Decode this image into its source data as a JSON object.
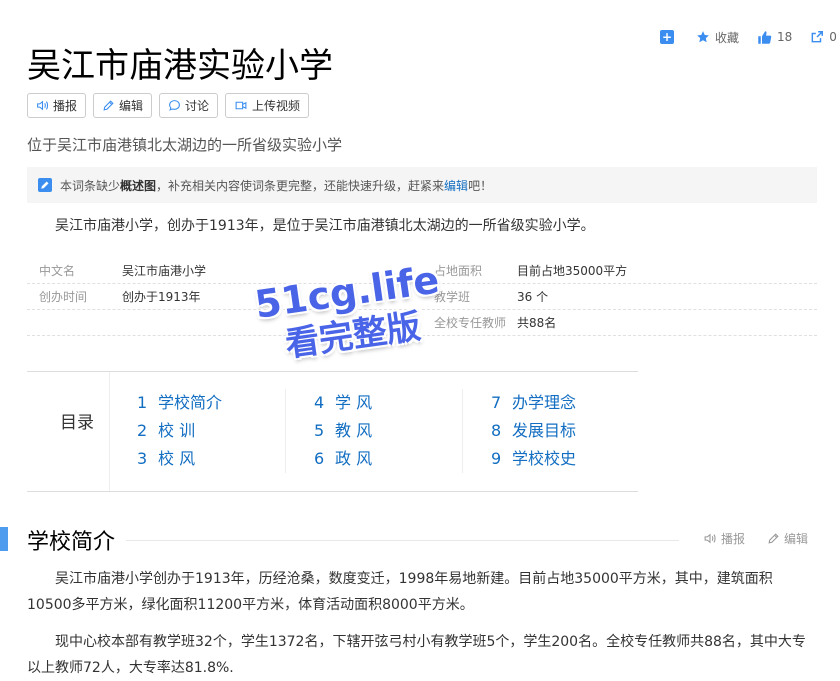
{
  "actions": {
    "collect": "收藏",
    "likes": "18",
    "shares": "0"
  },
  "title": "吴江市庙港实验小学",
  "tools": [
    "播报",
    "编辑",
    "讨论",
    "上传视频"
  ],
  "summary": "位于吴江市庙港镇北太湖边的一所省级实验小学",
  "notice": {
    "prefix": "本词条缺少",
    "bold": "概述图",
    "middle": "，补充相关内容使词条更完整，还能快速升级，赶紧来",
    "link": "编辑",
    "suffix": "吧！"
  },
  "lead": "吴江市庙港小学，创办于1913年，是位于吴江市庙港镇北太湖边的一所省级实验小学。",
  "info": {
    "left": [
      {
        "k": "中文名",
        "v": "吴江市庙港小学"
      },
      {
        "k": "创办时间",
        "v": "创办于1913年"
      }
    ],
    "right": [
      {
        "k": "占地面积",
        "v": "目前占地35000平方"
      },
      {
        "k": "教学班",
        "v": "36 个"
      },
      {
        "k": "全校专任教师",
        "v": "共88名"
      }
    ]
  },
  "watermark": {
    "line1": "51cg.life",
    "line2": "看完整版"
  },
  "toc": {
    "label": "目录",
    "columns": [
      [
        {
          "n": "1",
          "t": "学校简介"
        },
        {
          "n": "2",
          "t": "校 训"
        },
        {
          "n": "3",
          "t": "校 风"
        }
      ],
      [
        {
          "n": "4",
          "t": "学 风"
        },
        {
          "n": "5",
          "t": "教 风"
        },
        {
          "n": "6",
          "t": "政 风"
        }
      ],
      [
        {
          "n": "7",
          "t": "办学理念"
        },
        {
          "n": "8",
          "t": "发展目标"
        },
        {
          "n": "9",
          "t": "学校校史"
        }
      ]
    ]
  },
  "section": {
    "title": "学校简介",
    "broadcast": "播报",
    "edit": "编辑"
  },
  "paragraphs": [
    "吴江市庙港小学创办于1913年，历经沧桑，数度变迁，1998年易地新建。目前占地35000平方米，其中，建筑面积10500多平方米，绿化面积11200平方米，体育活动面积8000平方米。",
    "现中心校本部有教学班32个，学生1372名，下辖开弦弓村小有教学班5个，学生200名。全校专任教师共88名，其中大专以上教师72人，大专率达81.8%."
  ],
  "colors": {
    "link": "#136ec2",
    "accent": "#4f9cee",
    "watermark": "#4a64e8"
  }
}
